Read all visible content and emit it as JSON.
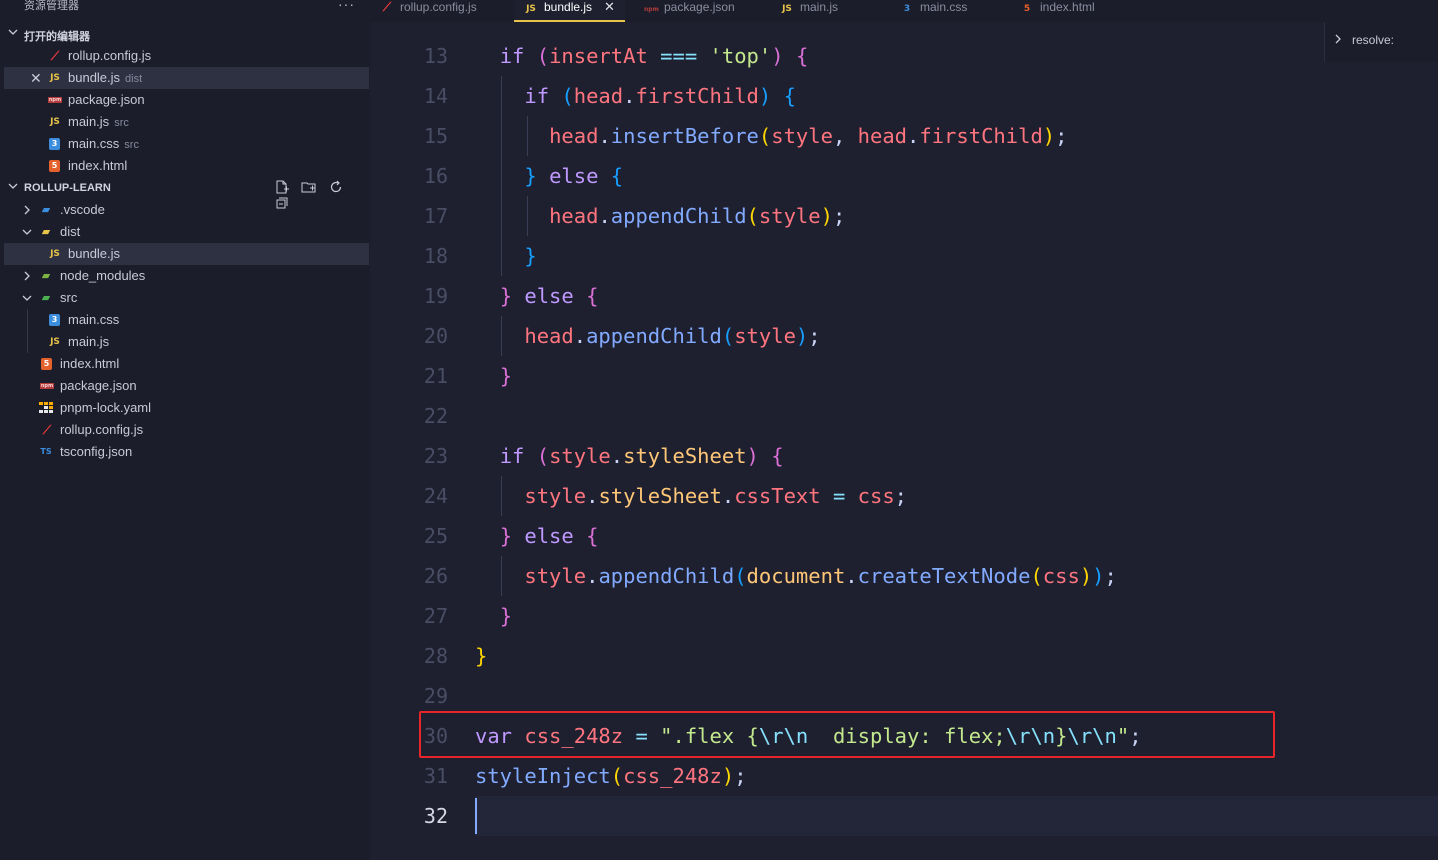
{
  "explorer": {
    "title": "资源管理器",
    "more": "···",
    "open_editors_header": "打开的编辑器",
    "open_editors": [
      {
        "name": "rollup.config.js",
        "desc": "",
        "icon": "rollup-icon"
      },
      {
        "name": "bundle.js",
        "desc": "dist",
        "icon": "js-icon"
      },
      {
        "name": "package.json",
        "desc": "",
        "icon": "npm-icon"
      },
      {
        "name": "main.js",
        "desc": "src",
        "icon": "js-icon"
      },
      {
        "name": "main.css",
        "desc": "src",
        "icon": "css-icon"
      },
      {
        "name": "index.html",
        "desc": "",
        "icon": "html-icon"
      }
    ],
    "project_header": "ROLLUP-LEARN",
    "tree": [
      {
        "name": ".vscode"
      },
      {
        "name": "dist"
      },
      {
        "name": "bundle.js"
      },
      {
        "name": "node_modules"
      },
      {
        "name": "src"
      },
      {
        "name": "main.css"
      },
      {
        "name": "main.js"
      },
      {
        "name": "index.html"
      },
      {
        "name": "package.json"
      },
      {
        "name": "pnpm-lock.yaml"
      },
      {
        "name": "rollup.config.js"
      },
      {
        "name": "tsconfig.json"
      }
    ],
    "icon_labels": {
      "js": "JS",
      "css": "3",
      "html": "5",
      "rollup": "⟋",
      "npm": "npm",
      "ts": "TS"
    }
  },
  "tabs": [
    {
      "label": "rollup.config.js"
    },
    {
      "label": "bundle.js",
      "close": "✕"
    },
    {
      "label": "package.json"
    },
    {
      "label": "main.js"
    },
    {
      "label": "main.css"
    },
    {
      "label": "index.html"
    }
  ],
  "editor": {
    "line_numbers": [
      "13",
      "14",
      "15",
      "16",
      "17",
      "18",
      "19",
      "20",
      "21",
      "22",
      "23",
      "24",
      "25",
      "26",
      "27",
      "28",
      "29",
      "30",
      "31",
      "32"
    ],
    "current_line": "32",
    "highlighted_line": "30"
  },
  "widget": {
    "label": "resolve:"
  },
  "colors": {
    "highlight_border": "#e8262a",
    "keyword": "#c099ff",
    "string": "#c3e88d",
    "variable": "#ff757f",
    "function": "#82aaff",
    "property": "#ffc777"
  }
}
